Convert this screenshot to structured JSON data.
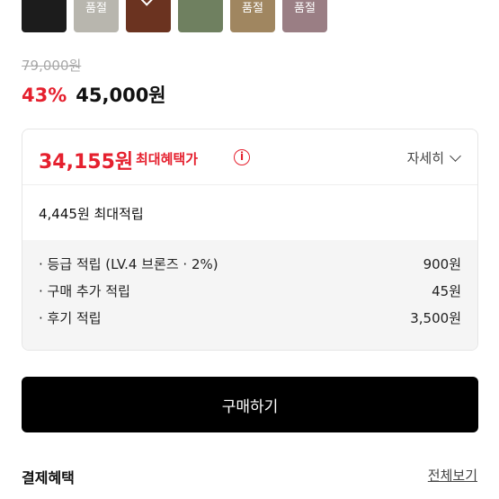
{
  "color_options": [
    {
      "label": "",
      "color": "#1c1c1c",
      "selected": false
    },
    {
      "label": "품절",
      "color": "#b8b6ae",
      "selected": false
    },
    {
      "label": "",
      "color": "#6b3320",
      "selected": true
    },
    {
      "label": "",
      "color": "#6f8060",
      "selected": false
    },
    {
      "label": "품절",
      "color": "#a08660",
      "selected": false
    },
    {
      "label": "품절",
      "color": "#9a7e84",
      "selected": false
    }
  ],
  "price": {
    "original": "79,000원",
    "discount_rate": "43%",
    "sale": "45,000원"
  },
  "max_benefit": {
    "price": "34,155원",
    "label": "최대혜택가",
    "info_icon": "i",
    "detail_label": "자세히"
  },
  "points": {
    "total_label": "4,445원 최대적립",
    "items": [
      {
        "label": "· 등급 적립 (LV.4 브론즈 · 2%)",
        "value": "900원"
      },
      {
        "label": "· 구매 추가 적립",
        "value": "45원"
      },
      {
        "label": "· 후기 적립",
        "value": "3,500원"
      }
    ]
  },
  "buy_button": "구매하기",
  "payment": {
    "title": "결제혜택",
    "view_all": "전체보기"
  },
  "colors": {
    "accent_red": "#e5202e",
    "buy_button_bg": "#000000",
    "points_bg": "#f5f5f5"
  }
}
